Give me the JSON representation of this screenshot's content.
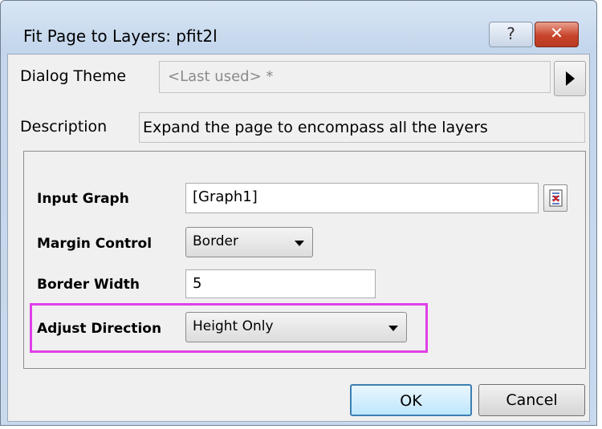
{
  "window": {
    "title": "Fit Page to Layers: pfit2l",
    "help_icon": "?",
    "close_icon": "✕"
  },
  "theme": {
    "label": "Dialog Theme",
    "value": "<Last used> *"
  },
  "description": {
    "label": "Description",
    "text": "Expand the page to encompass all the layers"
  },
  "fields": {
    "input_graph": {
      "label": "Input Graph",
      "value": "[Graph1]"
    },
    "margin_control": {
      "label": "Margin Control",
      "value": "Border"
    },
    "border_width": {
      "label": "Border Width",
      "value": "5"
    },
    "adjust_direction": {
      "label": "Adjust Direction",
      "value": "Height Only"
    }
  },
  "buttons": {
    "ok": "OK",
    "cancel": "Cancel"
  },
  "colors": {
    "highlight": "#e040e8",
    "close_button": "#c8442c"
  }
}
